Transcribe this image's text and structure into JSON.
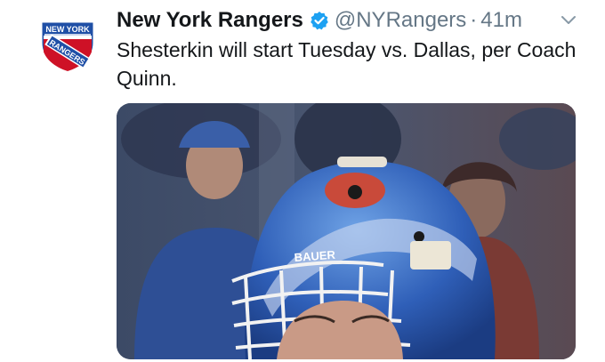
{
  "tweet": {
    "display_name": "New York Rangers",
    "handle": "@NYRangers",
    "separator": "·",
    "timestamp": "41m",
    "text": "Shesterkin will start Tuesday vs. Dallas, per Coach Quinn.",
    "verified": true
  },
  "avatar": {
    "logo_top": "NEW YORK",
    "logo_banner": "RANGERS"
  },
  "media": {
    "mask_brand": "BAUER"
  },
  "colors": {
    "rangers_blue": "#1f4fa6",
    "rangers_red": "#ce1126",
    "verified_blue": "#1da1f2",
    "text_primary": "#14171a",
    "text_secondary": "#657786"
  },
  "icons": {
    "verified": "verified-badge-icon",
    "menu": "chevron-down-icon"
  }
}
